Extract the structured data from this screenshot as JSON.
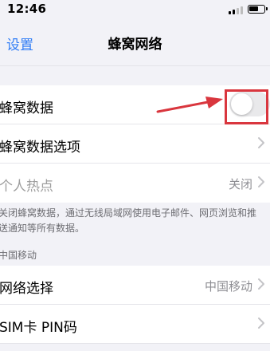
{
  "status_bar": {
    "time": "12:46"
  },
  "nav": {
    "back_label": "设置",
    "title": "蜂窝网络"
  },
  "rows": {
    "cellular_data": {
      "label": "蜂窝数据",
      "toggle_on": false
    },
    "cellular_options": {
      "label": "蜂窝数据选项"
    },
    "hotspot": {
      "label": "个人热点",
      "value": "关闭"
    }
  },
  "footnote": "关闭蜂窝数据，通过无线局域网使用电子邮件、网页浏览和推送通知等所有数据。",
  "carrier_section": {
    "header": "中国移动",
    "network_select": {
      "label": "网络选择",
      "value": "中国移动"
    },
    "sim_pin": {
      "label": "SIM卡 PIN码"
    }
  },
  "colors": {
    "accent": "#2f7cf6",
    "annotation": "#d9363e",
    "toggle_off": "#e9e9eb"
  }
}
